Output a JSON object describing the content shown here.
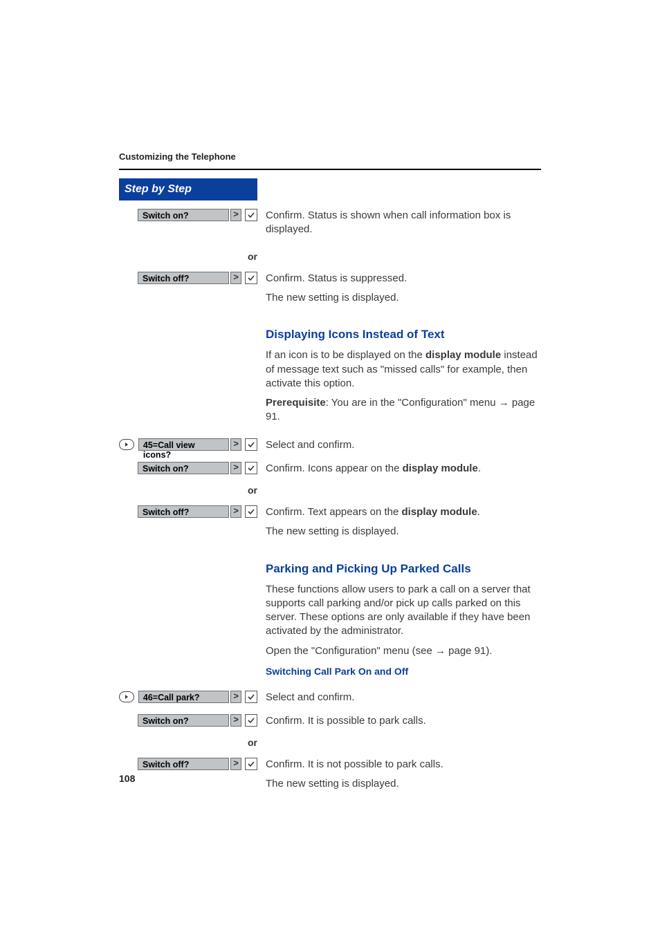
{
  "running_head": "Customizing the Telephone",
  "step_header": "Step by Step",
  "gt": ">",
  "or": "or",
  "page_number": "108",
  "s1": {
    "switch_on": "Switch on?",
    "switch_off": "Switch off?",
    "confirm_on": "Confirm. Status is shown when call information box is displayed.",
    "confirm_off": "Confirm. Status is suppressed.",
    "new_setting": "The new setting is displayed."
  },
  "s2": {
    "title": "Displaying Icons Instead of Text",
    "intro_pre": "If an icon is to be displayed on the ",
    "intro_bold": "display module",
    "intro_post": " instead of message text such as \"missed calls\" for example, then activate this option.",
    "prereq_bold": "Prerequisite",
    "prereq_rest": ": You are in the \"Configuration\" menu ",
    "prereq_ref": "page 91.",
    "menu_label": "45=Call view icons?",
    "select_confirm": "Select and confirm.",
    "switch_on": "Switch on?",
    "switch_off": "Switch off?",
    "confirm_on_pre": "Confirm. Icons appear on the ",
    "confirm_on_bold": "display module",
    "confirm_on_post": ".",
    "confirm_off_pre": "Confirm. Text appears on the ",
    "confirm_off_bold": "display module",
    "confirm_off_post": ".",
    "new_setting": "The new setting is displayed."
  },
  "s3": {
    "title": "Parking and Picking Up Parked Calls",
    "intro": "These functions allow users to park a call on a server that supports call parking and/or pick up calls parked on this server. These options are only available if they have been activated by the administrator.",
    "open_cfg_pre": "Open the \"Configuration\" menu (see ",
    "open_cfg_ref": "page 91",
    "open_cfg_post": ").",
    "sub_title": "Switching Call Park On and Off",
    "menu_label": "46=Call park?",
    "select_confirm": "Select and confirm.",
    "switch_on": "Switch on?",
    "switch_off": "Switch off?",
    "confirm_on": "Confirm. It is possible to park calls.",
    "confirm_off": "Confirm. It is not possible to park calls.",
    "new_setting": "The new setting is displayed."
  }
}
